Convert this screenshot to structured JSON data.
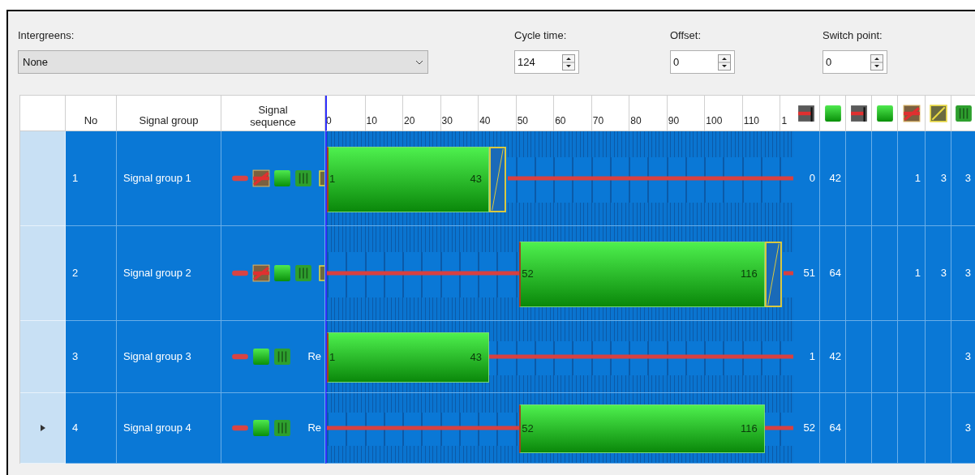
{
  "intergreens": {
    "label": "Intergreens:",
    "value": "None"
  },
  "settings": [
    {
      "label": "Cycle time:",
      "value": "124"
    },
    {
      "label": "Offset:",
      "value": "0"
    },
    {
      "label": "Switch point:",
      "value": "0"
    }
  ],
  "table": {
    "columns": [
      "No",
      "Signal group",
      "Signal sequence"
    ],
    "timeline_ticks": [
      "0",
      "10",
      "20",
      "30",
      "40",
      "50",
      "60",
      "70",
      "80",
      "90",
      "100",
      "110",
      "1"
    ],
    "icon_columns": [
      {
        "kind": "stop_box"
      },
      {
        "kind": "green"
      },
      {
        "kind": "stop_box"
      },
      {
        "kind": "green"
      },
      {
        "kind": "red_amber"
      },
      {
        "kind": "amber"
      },
      {
        "kind": "flashing"
      }
    ],
    "rows": [
      {
        "current": false,
        "no": "1",
        "name": "Signal group 1",
        "sequence": [
          {
            "kind": "stop"
          },
          {
            "kind": "red_amber"
          },
          {
            "kind": "green"
          },
          {
            "kind": "flashing"
          },
          {
            "kind": "amber"
          }
        ],
        "green": {
          "start": "1",
          "end": "43"
        },
        "amber": true,
        "values": {
          "column_1": "0",
          "column_2": "42",
          "column_5": "1",
          "column_6": "3",
          "column_7": "3"
        }
      },
      {
        "current": false,
        "no": "2",
        "name": "Signal group 2",
        "sequence": [
          {
            "kind": "stop"
          },
          {
            "kind": "red_amber"
          },
          {
            "kind": "green"
          },
          {
            "kind": "flashing"
          },
          {
            "kind": "amber"
          }
        ],
        "green": {
          "start": "52",
          "end": "116"
        },
        "amber": true,
        "values": {
          "column_1": "51",
          "column_2": "64",
          "column_5": "1",
          "column_6": "3",
          "column_7": "3"
        }
      },
      {
        "current": false,
        "no": "3",
        "name": "Signal group 3",
        "sequence": [
          {
            "kind": "stop"
          },
          {
            "kind": "green"
          },
          {
            "kind": "flashing"
          },
          {
            "kind": "text",
            "text": "Re"
          }
        ],
        "green": {
          "start": "1",
          "end": "43"
        },
        "amber": false,
        "values": {
          "column_1": "1",
          "column_2": "42",
          "column_7": "3"
        }
      },
      {
        "current": true,
        "no": "4",
        "name": "Signal group 4",
        "sequence": [
          {
            "kind": "stop"
          },
          {
            "kind": "green"
          },
          {
            "kind": "flashing"
          },
          {
            "kind": "text",
            "text": "Re"
          }
        ],
        "green": {
          "start": "52",
          "end": "116"
        },
        "amber": false,
        "values": {
          "column_1": "52",
          "column_2": "64",
          "column_7": "3"
        }
      }
    ]
  }
}
